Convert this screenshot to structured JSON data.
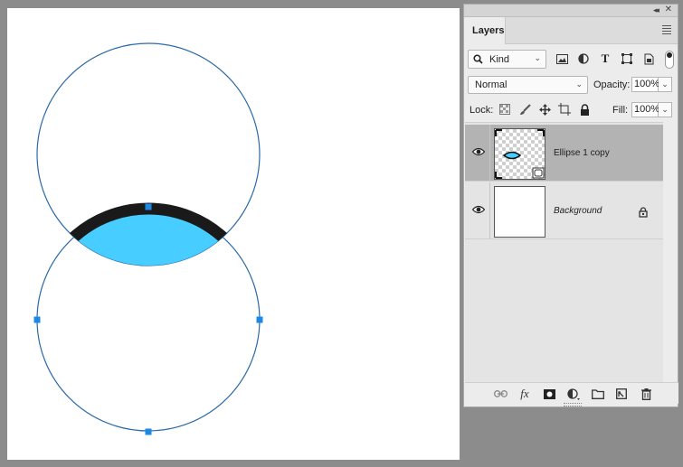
{
  "panel": {
    "tab_label": "Layers",
    "collapse_glyph": "◂◂",
    "close_glyph": "✕"
  },
  "filter": {
    "kind_label": "Kind",
    "buttons": [
      "pixel-filter-icon",
      "adjustment-filter-icon",
      "type-filter-icon",
      "shape-filter-icon",
      "smart-object-filter-icon"
    ],
    "type_glyph": "T"
  },
  "blend": {
    "mode": "Normal",
    "opacity_label": "Opacity:",
    "opacity_value": "100%"
  },
  "lock": {
    "label": "Lock:",
    "fill_label": "Fill:",
    "fill_value": "100%"
  },
  "layers": [
    {
      "name": "Ellipse 1 copy",
      "visible": true,
      "selected": true
    },
    {
      "name": "Background",
      "visible": true,
      "selected": false,
      "locked": true
    }
  ],
  "bottom_bar": {
    "fx_glyph": "fx"
  },
  "colors": {
    "shape_fill": "#47cdff",
    "shape_stroke": "#1a1a1a",
    "path_outline": "#2c6aa8",
    "anchor": "#1e88e5"
  }
}
